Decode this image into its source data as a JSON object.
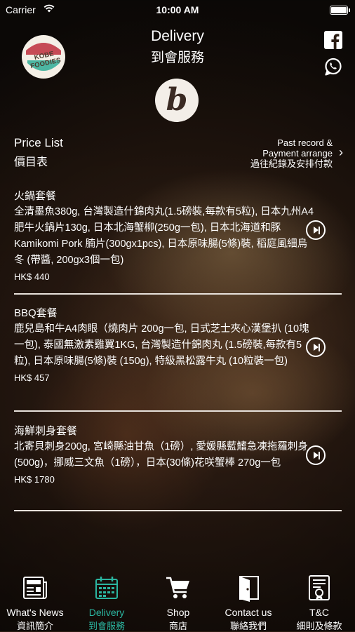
{
  "status_bar": {
    "carrier": "Carrier",
    "time": "10:00 AM"
  },
  "header": {
    "logo_text": "KOBE FOODIES",
    "title_en": "Delivery",
    "title_zh": "到會服務",
    "brand_letter": "b"
  },
  "price_list": {
    "title_en": "Price List",
    "title_zh": "價目表",
    "past_record_line1": "Past record &",
    "past_record_line2": "Payment arrange",
    "past_record_line3": "過往紀錄及安排付款",
    "arrow": "›"
  },
  "items": [
    {
      "name": "火鍋套餐",
      "description": "全清墨魚380g, 台灣製造什錦肉丸(1.5磅裝,每款有5粒), 日本九州A4肥牛火鍋片130g, 日本北海蟹柳(250g一包), 日本北海道和豚Kamikomi Pork 腩片(300gx1pcs), 日本原味腸(5條)裝, 稻庭風細烏冬 (帶醬, 200gx3個一包)",
      "price": "HK$ 440"
    },
    {
      "name": "BBQ套餐",
      "description": "鹿兒島和牛A4肉眼（燒肉片 200g一包, 日式芝士夾心漢堡扒 (10塊一包), 泰國無激素雞翼1KG, 台灣製造什錦肉丸 (1.5磅裝,每款有5粒), 日本原味腸(5條)裝 (150g), 特級黑松露牛丸 (10粒裝一包)",
      "price": "HK$ 457"
    },
    {
      "name": "海鮮刺身套餐",
      "description": "北寄貝刺身200g, 宮崎縣油甘魚（1磅）, 愛媛縣藍鰭急凍拖羅刺身 (500g)，挪威三文魚（1磅），日本(30條)花咲蟹棒 270g一包",
      "price": "HK$ 1780"
    }
  ],
  "tabs": [
    {
      "label_en": "What's News",
      "label_zh": "資訊簡介",
      "icon": "newspaper-icon"
    },
    {
      "label_en": "Delivery",
      "label_zh": "到會服務",
      "icon": "calendar-icon"
    },
    {
      "label_en": "Shop",
      "label_zh": "商店",
      "icon": "cart-icon"
    },
    {
      "label_en": "Contact us",
      "label_zh": "聯絡我們",
      "icon": "door-icon"
    },
    {
      "label_en": "T&C",
      "label_zh": "細則及條款",
      "icon": "document-icon"
    }
  ],
  "colors": {
    "accent": "#2bb5a0",
    "text": "#ffffff",
    "divider": "#e8e2dc"
  }
}
